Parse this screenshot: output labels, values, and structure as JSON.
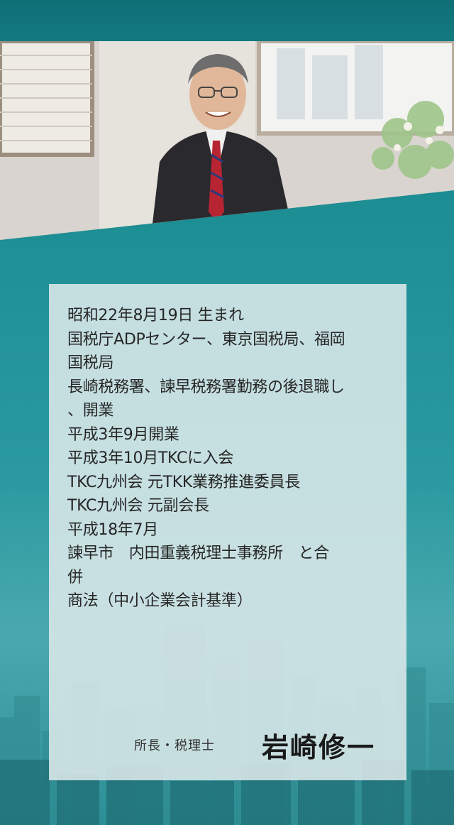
{
  "profile": {
    "bio_lines": [
      "昭和22年8月19日 生まれ",
      "国税庁ADPセンター、東京国税局、福岡",
      "国税局",
      "長崎税務署、諫早税務署勤務の後退職し",
      "、開業",
      "平成3年9月開業",
      "平成3年10月TKCに入会",
      "TKC九州会 元TKK業務推進委員長",
      "TKC九州会 元副会長",
      "平成18年7月",
      "諫早市　内田重義税理士事務所　と合",
      "併",
      "商法（中小企業会計基準）"
    ],
    "title": "所長・税理士",
    "name": "岩崎修一"
  },
  "colors": {
    "teal": "#1d8d92",
    "teal_dark": "#0f6f77",
    "card": "#dce8e9",
    "text": "#262626"
  }
}
